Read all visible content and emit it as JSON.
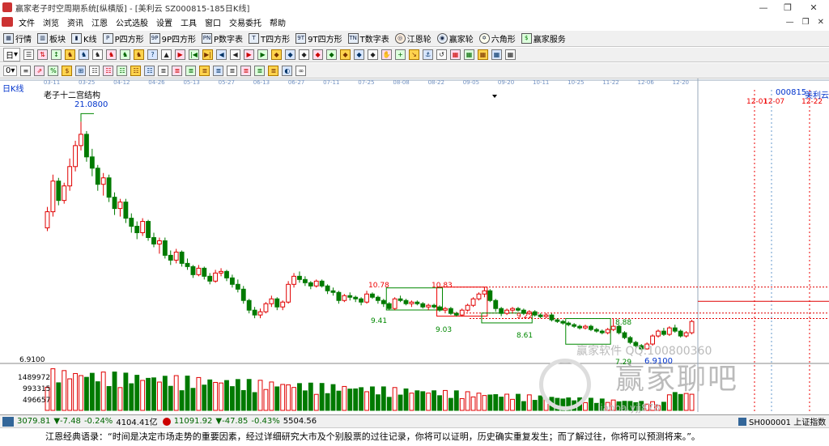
{
  "window": {
    "title": "赢家老子时空周期系统[纵横版] - [美利云  SZ000815-185日K线]",
    "min": "—",
    "max": "❐",
    "close": "✕"
  },
  "menu": [
    "文件",
    "浏览",
    "资讯",
    "江恩",
    "公式选股",
    "设置",
    "工具",
    "窗口",
    "交易委托",
    "帮助"
  ],
  "mdi": [
    "—",
    "❐",
    "✕"
  ],
  "toolbar1": [
    {
      "icon": "grid-icon",
      "label": "行情"
    },
    {
      "icon": "blocks-icon",
      "label": "板块"
    },
    {
      "icon": "kline-icon",
      "label": "K线"
    },
    {
      "icon": "p-box-icon",
      "label": "P四方形"
    },
    {
      "icon": "9p-box-icon",
      "label": "9P四方形"
    },
    {
      "icon": "pn-icon",
      "label": "P数字表"
    },
    {
      "icon": "t-box-icon",
      "label": "T四方形"
    },
    {
      "icon": "9t-box-icon",
      "label": "9T四方形"
    },
    {
      "icon": "tn-icon",
      "label": "T数字表"
    },
    {
      "icon": "gann-wheel-icon",
      "label": "江恩轮"
    },
    {
      "icon": "winner-wheel-icon",
      "label": "赢家轮"
    },
    {
      "icon": "hexagon-icon",
      "label": "六角形"
    },
    {
      "icon": "dollar-icon",
      "label": "赢家服务"
    }
  ],
  "toolbar2_sel": {
    "first": "日",
    "second": "0"
  },
  "tool_glyphs2": [
    "☰",
    "⇅",
    "↕",
    "♞",
    "♞",
    "♞",
    "♞",
    "♞",
    "♞",
    "?",
    "▲",
    "▶",
    "|◀",
    "▶|",
    "◀",
    "◀",
    "▶",
    "▶",
    "◆",
    "◆",
    "◆",
    "◆",
    "◆",
    "◆",
    "◆",
    "◆",
    "✋",
    "+",
    "↘",
    "⚓",
    "↺",
    "▦",
    "▦",
    "▦",
    "▦",
    "▦"
  ],
  "tool_glyphs3": [
    "≡",
    "⇗",
    "%",
    "$",
    "⊞",
    "☷",
    "☷",
    "☷",
    "☷",
    "☷",
    "≣",
    "≣",
    "≣",
    "≣",
    "≣",
    "≣",
    "≣",
    "≣",
    "≣",
    "◐",
    "∞"
  ],
  "chart": {
    "period_label": "日K线",
    "study_label": "老子十二宫结构",
    "stock_code": "000815",
    "stock_name": "美利云",
    "date_ticks": [
      "03-11",
      "03-25",
      "04-12",
      "04-26",
      "05-13",
      "05-27",
      "06-13",
      "06-27",
      "07-11",
      "07-25",
      "08-08",
      "08-22",
      "09-05",
      "09-20",
      "10-11",
      "10-25",
      "11-22",
      "12-06",
      "12-20"
    ],
    "future_marks": [
      "12-01",
      "12-07",
      "12-22"
    ],
    "high_label": "21.0800",
    "low_label": "6.9100",
    "box_labels": [
      {
        "t": "10.78"
      },
      {
        "t": "9.41"
      },
      {
        "t": "10.83"
      },
      {
        "t": "9.03"
      },
      {
        "t": "9.22"
      },
      {
        "t": "8.61"
      },
      {
        "t": "8.88"
      },
      {
        "t": "7.29"
      }
    ],
    "price_axis_label": "6.9100",
    "vol_labels": [
      "1489972",
      "993315",
      "496657"
    ],
    "watermark_big": "赢家聊吧",
    "watermark_small": "赢家软件  QQ:100800360",
    "watermark_url": "liaoba.yjj878"
  },
  "chart_data": {
    "type": "candlestick",
    "low": 6.91,
    "high": 21.08,
    "ohlc": [
      [
        14.5,
        15.8,
        14.3,
        15.5
      ],
      [
        15.5,
        17.8,
        15.2,
        17.4
      ],
      [
        17.4,
        17.6,
        15.9,
        16.2
      ],
      [
        16.2,
        17.3,
        16,
        17.1
      ],
      [
        17.1,
        18.8,
        16.8,
        18.3
      ],
      [
        18.3,
        19.9,
        18,
        19.6
      ],
      [
        19.6,
        21.08,
        19.3,
        20.3
      ],
      [
        20.3,
        20.5,
        18.6,
        18.9
      ],
      [
        18.9,
        19.4,
        17.7,
        18.2
      ],
      [
        18.2,
        18.4,
        16.8,
        17.2
      ],
      [
        17.2,
        17.9,
        16.5,
        17.6
      ],
      [
        17.6,
        17.8,
        16.1,
        16.4
      ],
      [
        16.4,
        16.7,
        15.3,
        15.7
      ],
      [
        15.7,
        16.3,
        15.2,
        16.1
      ],
      [
        16.1,
        16.3,
        14.8,
        15.1
      ],
      [
        15.1,
        15.4,
        14.2,
        14.6
      ],
      [
        14.6,
        14.9,
        13.8,
        14.2
      ],
      [
        14.2,
        15.1,
        14,
        14.9
      ],
      [
        14.9,
        15,
        13.7,
        13.9
      ],
      [
        13.9,
        14.2,
        13.3,
        13.5
      ],
      [
        13.5,
        13.9,
        12.9,
        13.7
      ],
      [
        13.7,
        13.9,
        12.6,
        12.8
      ],
      [
        12.8,
        13.1,
        12.2,
        12.5
      ],
      [
        12.5,
        13.2,
        12.3,
        13
      ],
      [
        13,
        13.1,
        12.1,
        12.3
      ],
      [
        12.3,
        12.6,
        11.9,
        12.1
      ],
      [
        12.1,
        12.2,
        11.4,
        11.6
      ],
      [
        11.6,
        12.2,
        11.5,
        12
      ],
      [
        12,
        12.1,
        11.3,
        11.5
      ],
      [
        11.5,
        11.7,
        11,
        11.2
      ],
      [
        11.2,
        11.9,
        11.1,
        11.7
      ],
      [
        11.7,
        12,
        11.5,
        11.8
      ],
      [
        11.8,
        11.9,
        11.2,
        11.4
      ],
      [
        11.4,
        11.6,
        10.8,
        11
      ],
      [
        11,
        11.3,
        10.5,
        10.7
      ],
      [
        10.7,
        10.9,
        9.8,
        10
      ],
      [
        10,
        10.1,
        9.2,
        9.4
      ],
      [
        9.4,
        9.6,
        8.9,
        9.1
      ],
      [
        9.1,
        9.5,
        8.9,
        9.3
      ],
      [
        9.3,
        9.9,
        9.2,
        9.8
      ],
      [
        9.8,
        10.3,
        9.6,
        10.1
      ],
      [
        10.1,
        10.2,
        9.4,
        9.6
      ],
      [
        9.6,
        10,
        9.4,
        9.9
      ],
      [
        9.9,
        11.2,
        9.8,
        11
      ],
      [
        11,
        11.7,
        10.8,
        11.5
      ],
      [
        11.5,
        11.8,
        11.1,
        11.3
      ],
      [
        11.3,
        11.5,
        10.9,
        11.1
      ],
      [
        11.1,
        11.2,
        10.7,
        10.9
      ],
      [
        10.9,
        11.3,
        10.8,
        11.2
      ],
      [
        11.2,
        11.3,
        10.8,
        10.9
      ],
      [
        10.9,
        11,
        10.4,
        10.6
      ],
      [
        10.6,
        10.8,
        10.3,
        10.5
      ],
      [
        10.5,
        10.6,
        9.8,
        10
      ],
      [
        10,
        10.4,
        9.9,
        10.3
      ],
      [
        10.3,
        10.5,
        10,
        10.2
      ],
      [
        10.2,
        10.3,
        9.9,
        10.1
      ],
      [
        10.1,
        10.2,
        9.7,
        9.9
      ],
      [
        9.9,
        10.6,
        9.8,
        10.4
      ],
      [
        10.4,
        10.5,
        10.1,
        10.2
      ],
      [
        10.2,
        10.3,
        9.8,
        10
      ],
      [
        10,
        10.1,
        9.6,
        9.8
      ],
      [
        9.8,
        9.9,
        9.4,
        9.5
      ],
      [
        9.5,
        10.2,
        9.4,
        10.1
      ],
      [
        10.1,
        10.3,
        9.9,
        10
      ],
      [
        10,
        10.1,
        9.7,
        9.8
      ],
      [
        9.8,
        10,
        9.6,
        9.9
      ],
      [
        9.9,
        10,
        9.7,
        9.8
      ],
      [
        9.8,
        9.9,
        9.5,
        9.6
      ],
      [
        9.6,
        9.8,
        9.4,
        9.7
      ],
      [
        9.7,
        9.8,
        9.5,
        9.6
      ],
      [
        9.6,
        9.7,
        9.3,
        9.4
      ],
      [
        9.4,
        9.6,
        9.2,
        9.5
      ],
      [
        9.5,
        9.6,
        9.1,
        9.2
      ],
      [
        9.2,
        9.3,
        9,
        9.1
      ],
      [
        9.1,
        9.5,
        9,
        9.4
      ],
      [
        9.4,
        9.8,
        9.3,
        9.7
      ],
      [
        9.7,
        10.2,
        9.6,
        10.1
      ],
      [
        10.1,
        10.5,
        10,
        10.4
      ],
      [
        10.4,
        10.83,
        10.2,
        10.6
      ],
      [
        10.6,
        10.7,
        9.9,
        10
      ],
      [
        10,
        10.1,
        9.3,
        9.5
      ],
      [
        9.5,
        9.6,
        9.03,
        9.2
      ],
      [
        9.2,
        9.5,
        9.1,
        9.4
      ],
      [
        9.4,
        9.6,
        9.2,
        9.5
      ],
      [
        9.5,
        9.6,
        9.3,
        9.4
      ],
      [
        9.4,
        9.5,
        9.1,
        9.2
      ],
      [
        9.2,
        9.4,
        9.1,
        9.3
      ],
      [
        9.3,
        9.4,
        9,
        9.1
      ],
      [
        9.1,
        9.2,
        8.9,
        9
      ],
      [
        9,
        9.22,
        8.9,
        9.1
      ],
      [
        9.1,
        9.2,
        8.7,
        8.8
      ],
      [
        8.8,
        8.9,
        8.61,
        8.7
      ],
      [
        8.7,
        8.8,
        8.5,
        8.6
      ],
      [
        8.6,
        8.7,
        8.4,
        8.5
      ],
      [
        8.5,
        8.6,
        8.3,
        8.4
      ],
      [
        8.4,
        8.5,
        8.2,
        8.3
      ],
      [
        8.3,
        8.5,
        8.2,
        8.4
      ],
      [
        8.4,
        8.5,
        8.1,
        8.2
      ],
      [
        8.2,
        8.3,
        8,
        8.1
      ],
      [
        8.1,
        8.2,
        7.9,
        8
      ],
      [
        8,
        8.3,
        7.9,
        8.2
      ],
      [
        8.2,
        8.88,
        8.1,
        8.4
      ],
      [
        8.4,
        8.5,
        7.9,
        8
      ],
      [
        8,
        8.1,
        7.6,
        7.7
      ],
      [
        7.7,
        7.8,
        7.29,
        7.4
      ],
      [
        7.4,
        7.5,
        7.1,
        7.2
      ],
      [
        7.2,
        7.3,
        6.91,
        7
      ],
      [
        7,
        7.4,
        6.95,
        7.3
      ],
      [
        7.3,
        7.9,
        7.2,
        7.8
      ],
      [
        7.8,
        8.2,
        7.7,
        8.1
      ],
      [
        8.1,
        8.3,
        7.8,
        7.9
      ],
      [
        7.9,
        8.4,
        7.8,
        8.3
      ],
      [
        8.3,
        8.5,
        8,
        8.1
      ],
      [
        8.1,
        8.2,
        7.7,
        7.8
      ],
      [
        7.8,
        8.1,
        7.7,
        8
      ],
      [
        8,
        8.8,
        7.9,
        8.7
      ]
    ],
    "volume_max": 1489972
  },
  "status": {
    "sh_index": "3079.81",
    "sh_change": "▼-7.48",
    "sh_pct": "-0.24%",
    "sh_amount": "4104.41亿",
    "sz_index": "11091.92",
    "sz_change": "▼-47.85",
    "sz_pct": "-0.43%",
    "sz_amount": "5504.56",
    "right": "SH000001 上证指数"
  },
  "quote": "江恩经典语录：“时间是决定市场走势的重要因素，经过详细研究大市及个别股票的过往记录，你将可以证明，历史确实重复发生；而了解过往，你将可以预测将来。”。",
  "colors": {
    "up": "#e00000",
    "down": "#007a00",
    "red_line": "#e00000",
    "axis": "#7090c0"
  }
}
